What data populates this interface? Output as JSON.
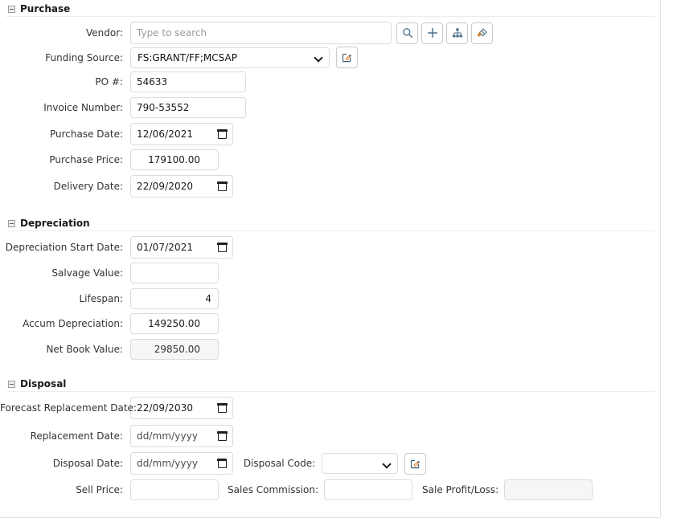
{
  "sections": [
    {
      "id": "purchase",
      "title": "Purchase",
      "collapse_icon": "minus-square-icon"
    },
    {
      "id": "depreciation",
      "title": "Depreciation",
      "collapse_icon": "minus-square-icon"
    },
    {
      "id": "disposal",
      "title": "Disposal",
      "collapse_icon": "minus-square-icon"
    }
  ],
  "purchase": {
    "vendor": {
      "label": "Vendor:",
      "value": "",
      "placeholder": "Type to search"
    },
    "vendor_buttons": [
      {
        "name": "search-icon",
        "title": "Search"
      },
      {
        "name": "plus-icon",
        "title": "Add"
      },
      {
        "name": "sitemap-icon",
        "title": "Hierarchy"
      },
      {
        "name": "eraser-icon",
        "title": "Clear"
      }
    ],
    "funding_source": {
      "label": "Funding Source:",
      "value": "FS:GRANT/FF;MCSAP",
      "options": [
        "FS:GRANT/FF;MCSAP"
      ],
      "edit_icon": "edit-square-icon"
    },
    "po_number": {
      "label": "PO #:",
      "value": "54633"
    },
    "invoice_number": {
      "label": "Invoice Number:",
      "value": "790-53552"
    },
    "purchase_date": {
      "label": "Purchase Date:",
      "value": "12/06/2021",
      "icon": "calendar-icon"
    },
    "purchase_price": {
      "label": "Purchase Price:",
      "value": "179100.00"
    },
    "delivery_date": {
      "label": "Delivery Date:",
      "value": "22/09/2020",
      "icon": "calendar-icon"
    }
  },
  "depreciation": {
    "start_date": {
      "label": "Depreciation Start Date:",
      "value": "01/07/2021",
      "icon": "calendar-icon"
    },
    "salvage_value": {
      "label": "Salvage Value:",
      "value": ""
    },
    "lifespan": {
      "label": "Lifespan:",
      "value": "4"
    },
    "accum_depreciation": {
      "label": "Accum Depreciation:",
      "value": "149250.00"
    },
    "net_book_value": {
      "label": "Net Book Value:",
      "value": "29850.00",
      "readonly": true
    }
  },
  "disposal": {
    "forecast_replacement_date": {
      "label": "Forecast Replacement Date:",
      "value": "22/09/2030",
      "icon": "calendar-icon"
    },
    "replacement_date": {
      "label": "Replacement Date:",
      "value": "dd/mm/yyyy",
      "icon": "calendar-icon"
    },
    "disposal_date": {
      "label": "Disposal Date:",
      "value": "dd/mm/yyyy",
      "icon": "calendar-icon"
    },
    "disposal_code": {
      "label": "Disposal Code:",
      "value": "",
      "options": [],
      "edit_icon": "edit-square-icon"
    },
    "sell_price": {
      "label": "Sell Price:",
      "value": ""
    },
    "sales_commission": {
      "label": "Sales Commission:",
      "value": ""
    },
    "sale_profit_loss": {
      "label": "Sale Profit/Loss:",
      "value": "",
      "readonly": true
    }
  },
  "colors": {
    "icon_blue": "#4a6f8a",
    "icon_orange": "#e08a3c",
    "border": "#dcdcdc",
    "readonly_bg": "#f6f6f6"
  }
}
